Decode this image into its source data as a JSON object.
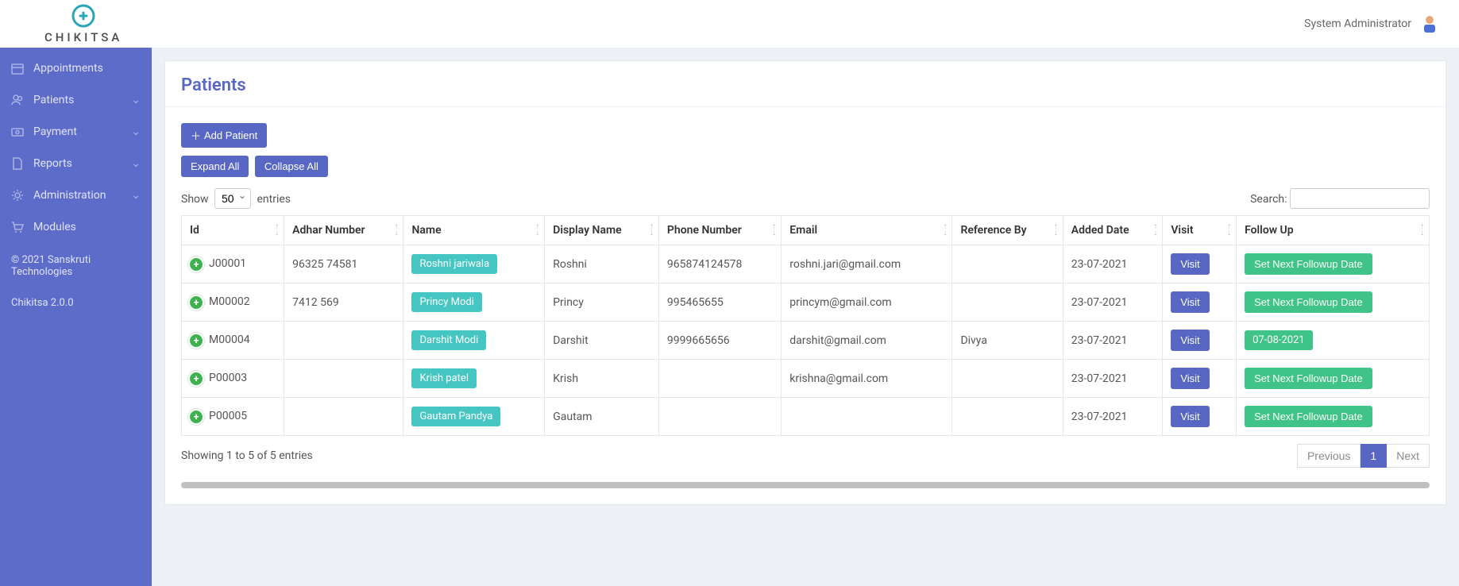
{
  "brand": {
    "name": "CHIKITSA"
  },
  "user": {
    "name": "System Administrator"
  },
  "sidebar": {
    "items": [
      {
        "icon": "calendar",
        "label": "Appointments",
        "expandable": false
      },
      {
        "icon": "users",
        "label": "Patients",
        "expandable": true
      },
      {
        "icon": "payment",
        "label": "Payment",
        "expandable": true
      },
      {
        "icon": "file",
        "label": "Reports",
        "expandable": true
      },
      {
        "icon": "gear",
        "label": "Administration",
        "expandable": true
      },
      {
        "icon": "cart",
        "label": "Modules",
        "expandable": false
      }
    ],
    "copyright": "© 2021 Sanskruti Technologies",
    "version": "Chikitsa 2.0.0"
  },
  "page": {
    "title": "Patients",
    "add_button": "Add Patient",
    "expand_all": "Expand All",
    "collapse_all": "Collapse All",
    "show_label_pre": "Show",
    "show_label_post": "entries",
    "page_size": "50",
    "search_label": "Search:",
    "info": "Showing 1 to 5 of 5 entries",
    "pager": {
      "prev": "Previous",
      "next": "Next",
      "current": "1"
    }
  },
  "table": {
    "columns": [
      "Id",
      "Adhar Number",
      "Name",
      "Display Name",
      "Phone Number",
      "Email",
      "Reference By",
      "Added Date",
      "Visit",
      "Follow Up"
    ],
    "visit_label": "Visit",
    "followup_label": "Set Next Followup Date",
    "rows": [
      {
        "id": "J00001",
        "adhar": "96325 74581",
        "name": "Roshni jariwala",
        "display": "Roshni",
        "phone": "965874124578",
        "email": "roshni.jari@gmail.com",
        "ref": "",
        "added": "23-07-2021",
        "follow": ""
      },
      {
        "id": "M00002",
        "adhar": "7412 569",
        "name": "Princy Modi",
        "display": "Princy",
        "phone": "995465655",
        "email": "princym@gmail.com",
        "ref": "",
        "added": "23-07-2021",
        "follow": ""
      },
      {
        "id": "M00004",
        "adhar": "",
        "name": "Darshit Modi",
        "display": "Darshit",
        "phone": "9999665656",
        "email": "darshit@gmail.com",
        "ref": "Divya",
        "added": "23-07-2021",
        "follow": "07-08-2021"
      },
      {
        "id": "P00003",
        "adhar": "",
        "name": "Krish patel",
        "display": "Krish",
        "phone": "",
        "email": "krishna@gmail.com",
        "ref": "",
        "added": "23-07-2021",
        "follow": ""
      },
      {
        "id": "P00005",
        "adhar": "",
        "name": "Gautam Pandya",
        "display": "Gautam",
        "phone": "",
        "email": "",
        "ref": "",
        "added": "23-07-2021",
        "follow": ""
      }
    ]
  }
}
